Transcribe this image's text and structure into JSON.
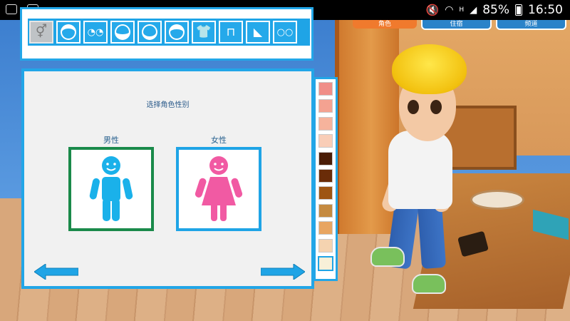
{
  "status_bar": {
    "battery": "85%",
    "time": "16:50",
    "network": "H"
  },
  "scene_nav": {
    "tabs": [
      {
        "label": "角色",
        "color": "#f07a2d"
      },
      {
        "label": "住宿",
        "color": "#ffffff"
      },
      {
        "label": "频道",
        "color": "#ffffff"
      }
    ]
  },
  "toolbar": {
    "items": [
      {
        "name": "gender",
        "icon": "gender-icon",
        "glyph": "⚥",
        "selected": true
      },
      {
        "name": "face",
        "icon": "face-icon",
        "glyph": "",
        "selected": false
      },
      {
        "name": "eyes",
        "icon": "eyes-icon",
        "glyph": "",
        "selected": false
      },
      {
        "name": "mouth",
        "icon": "mouth-icon",
        "glyph": "",
        "selected": false
      },
      {
        "name": "beard",
        "icon": "beard-icon",
        "glyph": "",
        "selected": false
      },
      {
        "name": "hat",
        "icon": "hat-icon",
        "glyph": "",
        "selected": false
      },
      {
        "name": "top",
        "icon": "shirt-icon",
        "glyph": "",
        "selected": false
      },
      {
        "name": "pants",
        "icon": "pants-icon",
        "glyph": "",
        "selected": false
      },
      {
        "name": "shoes",
        "icon": "shoe-icon",
        "glyph": "",
        "selected": false
      },
      {
        "name": "glasses",
        "icon": "glasses-icon",
        "glyph": "",
        "selected": false
      }
    ]
  },
  "panel": {
    "title": "选择角色性别",
    "male_label": "男性",
    "female_label": "女性",
    "male_color": "#1ab1ea",
    "female_color": "#f15aa3",
    "selected": "male"
  },
  "palette": {
    "swatches": [
      "#f08e88",
      "#f4a291",
      "#f6b39c",
      "#f9cdb7",
      "#4a1c06",
      "#6a2c08",
      "#9e5512",
      "#c58a3f",
      "#e8a561",
      "#f5d3b0",
      "#f8f0d8"
    ],
    "selected_index": 10
  }
}
